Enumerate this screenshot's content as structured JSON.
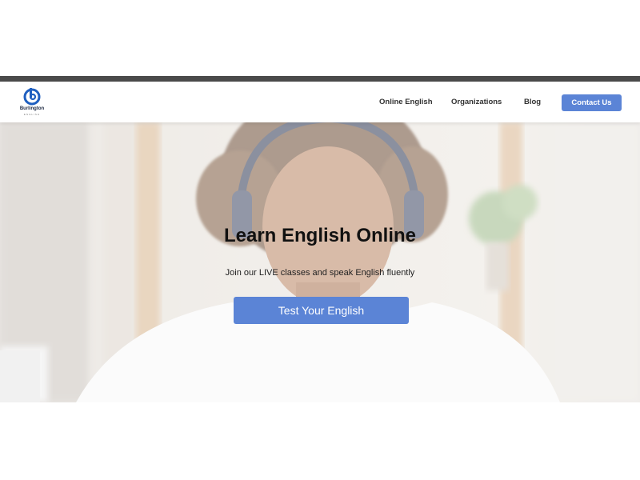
{
  "brand": {
    "name": "Burlington",
    "subtitle": "ENGLISH",
    "logo_icon": "b-circle-logo-icon",
    "color": "#1f5fc0"
  },
  "nav": {
    "items": [
      {
        "label": "Online English"
      },
      {
        "label": "Organizations"
      },
      {
        "label": "Blog"
      }
    ],
    "contact_label": "Contact Us"
  },
  "hero": {
    "title": "Learn English Online",
    "subtitle": "Join our LIVE classes and speak English fluently",
    "cta_label": "Test Your English",
    "image": "student-with-headphones-photo"
  },
  "colors": {
    "accent": "#5b84d6",
    "top_bar": "#4a4a4a",
    "text_dark": "#111111"
  }
}
